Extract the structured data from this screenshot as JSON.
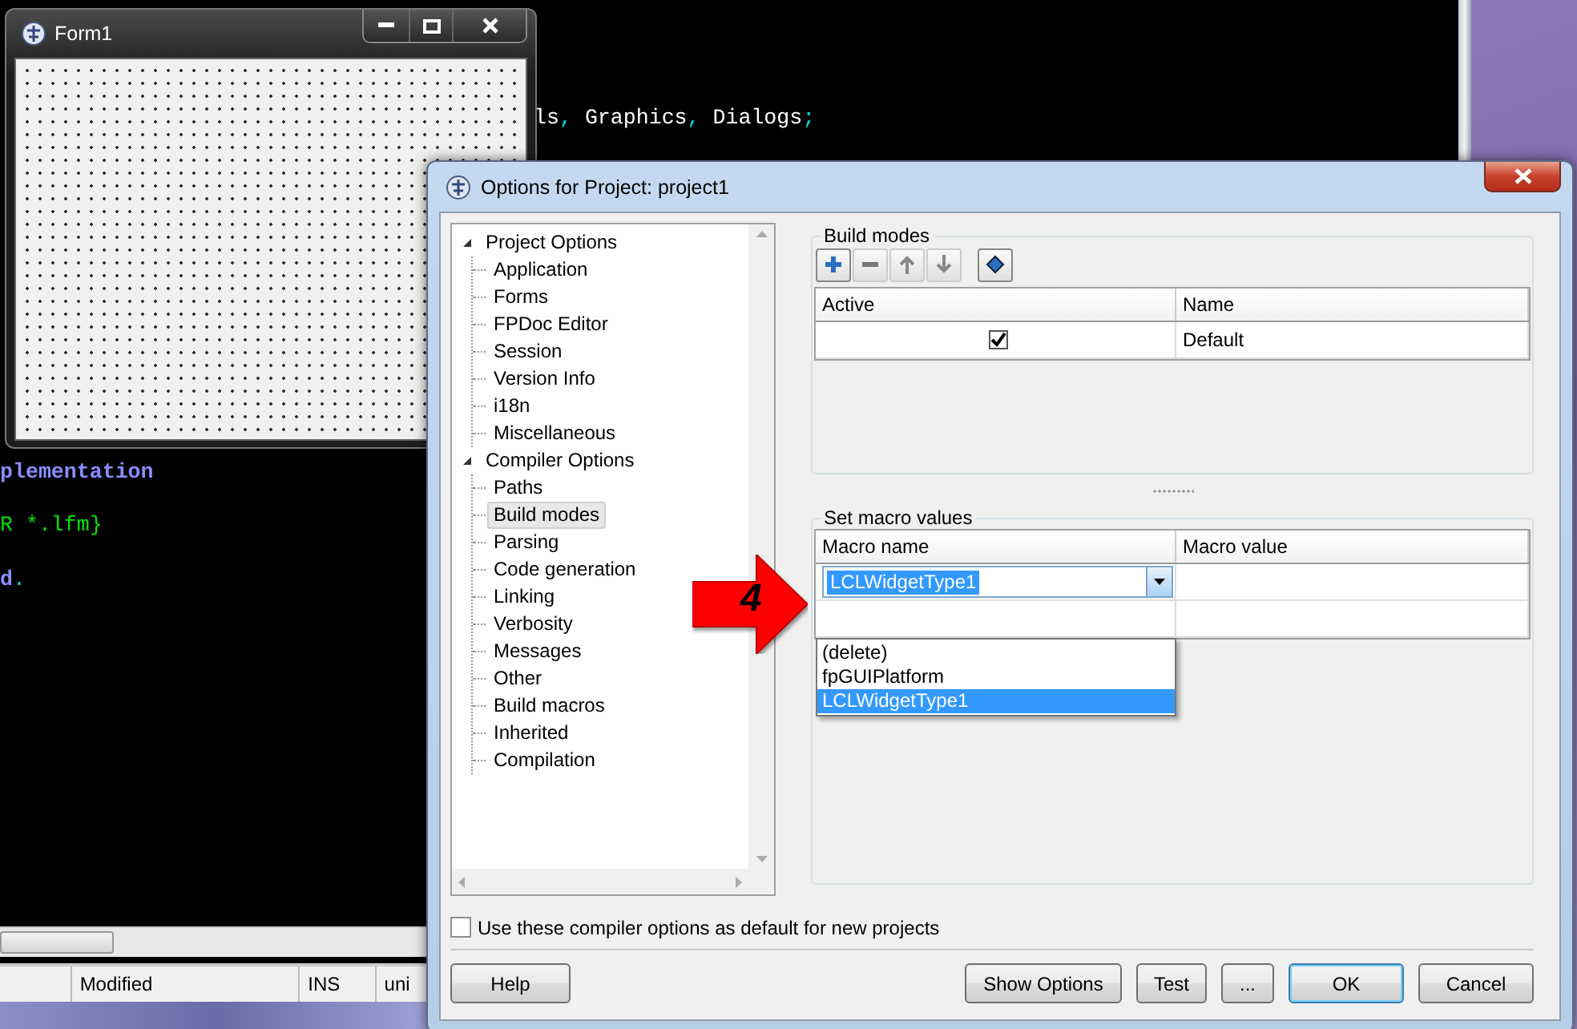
{
  "editor": {
    "code_lines": [
      {
        "segments": [
          {
            "text": "ls",
            "kind": "identifier"
          },
          {
            "text": ", ",
            "kind": "symbol"
          },
          {
            "text": "Graphics",
            "kind": "identifier"
          },
          {
            "text": ", ",
            "kind": "symbol"
          },
          {
            "text": "Dialogs",
            "kind": "identifier"
          },
          {
            "text": ";",
            "kind": "symbol"
          }
        ]
      },
      {
        "segments": [
          {
            "text": "plementation",
            "kind": "keyword"
          }
        ]
      },
      {
        "segments": [
          {
            "text": "R *.lfm}",
            "kind": "comment"
          }
        ]
      },
      {
        "segments": [
          {
            "text": "d",
            "kind": "keyword"
          },
          {
            "text": ".",
            "kind": "symbol"
          }
        ]
      }
    ],
    "status_bar": [
      "Modified",
      "INS",
      "uni"
    ]
  },
  "form_window": {
    "title": "Form1"
  },
  "dialog": {
    "title": "Options for Project: project1",
    "tree": [
      {
        "label": "Project Options",
        "expanded": true,
        "selected": false,
        "children": [
          {
            "label": "Application",
            "selected": false
          },
          {
            "label": "Forms",
            "selected": false
          },
          {
            "label": "FPDoc Editor",
            "selected": false
          },
          {
            "label": "Session",
            "selected": false
          },
          {
            "label": "Version Info",
            "selected": false
          },
          {
            "label": "i18n",
            "selected": false
          },
          {
            "label": "Miscellaneous",
            "selected": false
          }
        ]
      },
      {
        "label": "Compiler Options",
        "expanded": true,
        "selected": false,
        "children": [
          {
            "label": "Paths",
            "selected": false
          },
          {
            "label": "Build modes",
            "selected": true
          },
          {
            "label": "Parsing",
            "selected": false
          },
          {
            "label": "Code generation",
            "selected": false
          },
          {
            "label": "Linking",
            "selected": false
          },
          {
            "label": "Verbosity",
            "selected": false
          },
          {
            "label": "Messages",
            "selected": false
          },
          {
            "label": "Other",
            "selected": false
          },
          {
            "label": "Build macros",
            "selected": false
          },
          {
            "label": "Inherited",
            "selected": false
          },
          {
            "label": "Compilation",
            "selected": false
          }
        ]
      }
    ],
    "build_modes": {
      "title": "Build modes",
      "columns": [
        "Active",
        "Name"
      ],
      "rows": [
        {
          "active": true,
          "name": "Default"
        }
      ]
    },
    "macro_values": {
      "title": "Set macro values",
      "columns": [
        "Macro name",
        "Macro value"
      ],
      "combo_value": "LCLWidgetType1",
      "options": [
        {
          "label": "(delete)",
          "selected": false
        },
        {
          "label": "fpGUIPlatform",
          "selected": false
        },
        {
          "label": "LCLWidgetType1",
          "selected": true
        }
      ]
    },
    "callout": {
      "label": "4"
    },
    "default_checkbox": {
      "label": "Use these compiler options as default for new projects",
      "checked": false
    },
    "help_button": {
      "label": "Help",
      "default": false
    },
    "buttons": [
      {
        "label": "Show Options",
        "default": false
      },
      {
        "label": "Test",
        "default": false
      },
      {
        "label": "...",
        "default": false
      },
      {
        "label": "OK",
        "default": true
      },
      {
        "label": "Cancel",
        "default": false
      }
    ]
  }
}
